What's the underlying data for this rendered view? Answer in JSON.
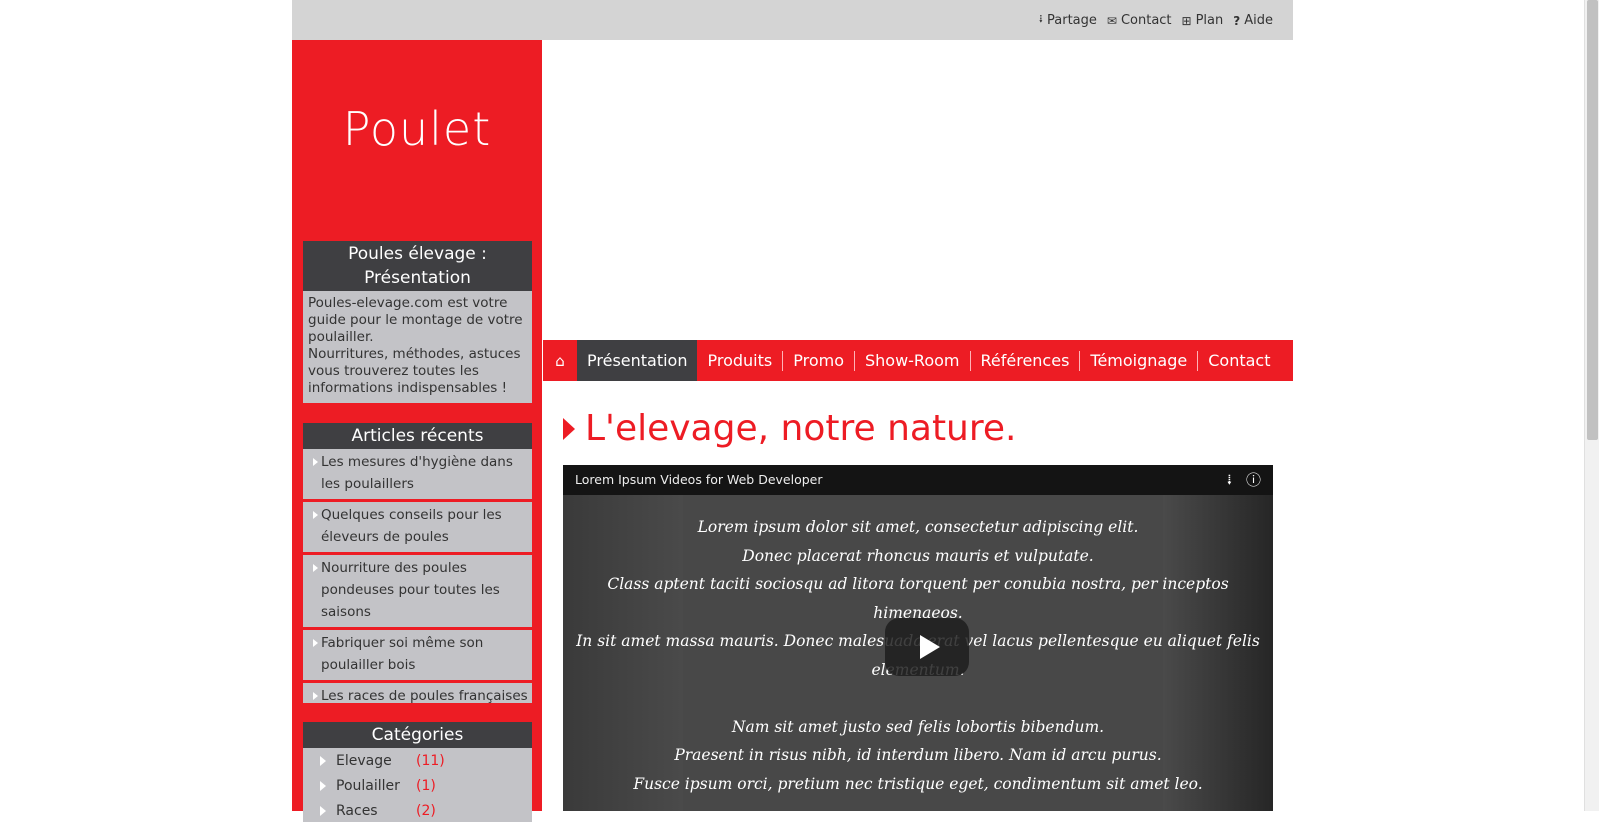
{
  "topbar": {
    "links": [
      {
        "icon": "share-icon",
        "glyph": "⋖",
        "label": "Partage"
      },
      {
        "icon": "envelope-icon",
        "glyph": "✉",
        "label": "Contact"
      },
      {
        "icon": "sitemap-icon",
        "glyph": "⊞",
        "label": "Plan"
      },
      {
        "icon": "question-icon",
        "glyph": "?",
        "label": "Aide"
      }
    ]
  },
  "site": {
    "logo": "Poulet"
  },
  "sidebar": {
    "presentation": {
      "title": "Poules élevage : Présentation",
      "text1": "Poules-elevage.com est votre guide pour le montage de votre poulailler.",
      "text2": "Nourritures, méthodes, astuces vous trouverez toutes les informations indispensables !"
    },
    "recent": {
      "title": "Articles récents",
      "items": [
        "Les mesures d'hygiène dans les poulaillers",
        "Quelques conseils pour les éleveurs de poules",
        "Nourriture des poules pondeuses pour toutes les saisons",
        "Fabriquer soi même son poulailler bois",
        "Les races de poules françaises"
      ]
    },
    "categories": {
      "title": "Catégories",
      "items": [
        {
          "name": "Elevage",
          "count": "(11)"
        },
        {
          "name": "Poulailler",
          "count": "(1)"
        },
        {
          "name": "Races",
          "count": "(2)"
        }
      ]
    }
  },
  "nav": {
    "home_icon": "home-icon",
    "items": [
      "Présentation",
      "Produits",
      "Promo",
      "Show-Room",
      "Références",
      "Témoignage",
      "Contact"
    ],
    "active": "Présentation"
  },
  "content": {
    "heading": "L'elevage, notre nature.",
    "video": {
      "title": "Lorem Ipsum Videos for Web Developer",
      "lines": [
        "Lorem ipsum dolor sit amet, consectetur adipiscing elit.",
        "Donec placerat rhoncus mauris et vulputate.",
        "Class aptent taciti sociosqu ad litora torquent per conubia nostra, per inceptos himenaeos.",
        "In sit amet massa mauris. Donec malesuada erat vel lacus pellentesque eu aliquet felis elementum.",
        "",
        "Nam sit amet justo sed felis lobortis bibendum.",
        "Praesent in risus nibh, id interdum libero. Nam id arcu purus.",
        "Fusce ipsum orci, pretium nec tristique eget, condimentum sit amet leo."
      ]
    }
  },
  "colors": {
    "brand_red": "#ed1c24",
    "dark_gray": "#3f3f42",
    "box_gray": "#c3c3c7",
    "topbar_gray": "#d4d4d4"
  }
}
